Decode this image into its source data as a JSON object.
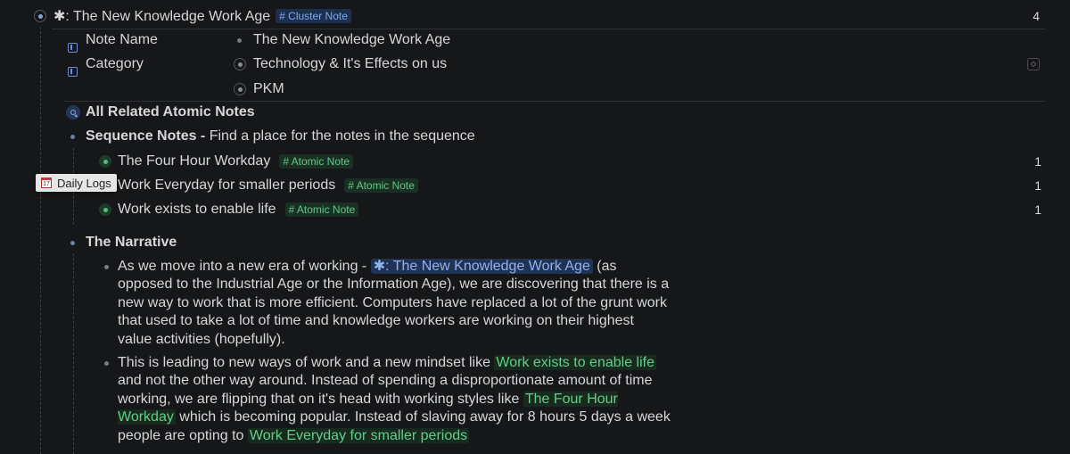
{
  "cluster": {
    "title": "✱: The New Knowledge Work Age",
    "tag": "# Cluster Note",
    "count": "4"
  },
  "properties": [
    {
      "name": "Note Name",
      "values": [
        "The New Knowledge Work Age"
      ]
    },
    {
      "name": "Category",
      "values": [
        "Technology & It's Effects on us",
        "PKM"
      ]
    }
  ],
  "query": {
    "title": "All Related Atomic Notes"
  },
  "sequence": {
    "label": "Sequence Notes -",
    "hint": "Find a place for the notes in the sequence",
    "items": [
      {
        "title": "The Four Hour Workday",
        "tag": "# Atomic Note",
        "count": "1"
      },
      {
        "title": "Work Everyday for smaller periods",
        "tag": "# Atomic Note",
        "count": "1"
      },
      {
        "title": "Work exists to enable life",
        "tag": "# Atomic Note",
        "count": "1"
      }
    ]
  },
  "tooltip": {
    "label": "Daily Logs"
  },
  "narrative": {
    "label": "The Narrative",
    "p1": {
      "pre": "As we move into a new era of working - ",
      "link": "✱: The New Knowledge Work Age",
      "post": " (as opposed to the Industrial Age or the Information Age), we are discovering that there is a new way to work that is more efficient. Computers have replaced a lot of the grunt work that used to take a lot of time and knowledge workers are working on their highest value activities (hopefully)."
    },
    "p2": {
      "a": "This is leading to new ways of work and a new mindset like ",
      "link1": "Work exists to enable life",
      "b": " and not the other way around. Instead of spending a disproportionate amount of time working, we are flipping that on it's head with working styles like ",
      "link2": "The Four Hour Workday",
      "c": " which is becoming popular. Instead of slaving away for 8 hours 5 days a week people are opting to ",
      "link3": "Work Everyday for smaller periods"
    }
  }
}
